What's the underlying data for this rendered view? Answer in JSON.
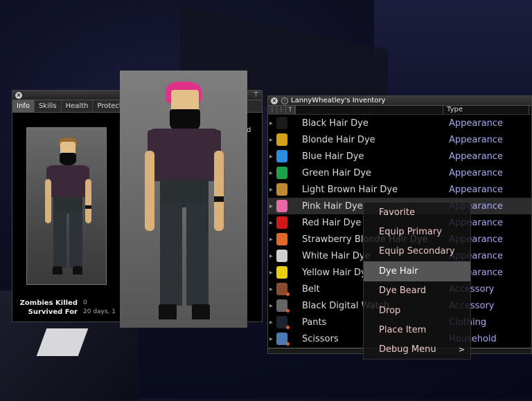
{
  "info_window": {
    "tabs": [
      {
        "label": "Info",
        "active": true
      },
      {
        "label": "Skills",
        "active": false
      },
      {
        "label": "Health",
        "active": false
      },
      {
        "label": "Protect",
        "active": false
      }
    ],
    "right_clip_text": "d",
    "stats": [
      {
        "label": "Zombies Killed",
        "value": "0"
      },
      {
        "label": "Survived For",
        "value": "20 days, 1"
      }
    ]
  },
  "inventory": {
    "title": "LannyWheatley's Inventory",
    "column_type": "Type",
    "items": [
      {
        "name": "Black Hair Dye",
        "type": "Appearance",
        "icon": "hair-dye-bottle-icon",
        "color": "#1a1a1a"
      },
      {
        "name": "Blonde Hair Dye",
        "type": "Appearance",
        "icon": "hair-dye-bottle-icon",
        "color": "#d4a017"
      },
      {
        "name": "Blue Hair Dye",
        "type": "Appearance",
        "icon": "hair-dye-bottle-icon",
        "color": "#2a8ee0"
      },
      {
        "name": "Green Hair Dye",
        "type": "Appearance",
        "icon": "hair-dye-bottle-icon",
        "color": "#1ea04a"
      },
      {
        "name": "Light Brown Hair Dye",
        "type": "Appearance",
        "icon": "hair-dye-bottle-icon",
        "color": "#c08830"
      },
      {
        "name": "Pink Hair Dye",
        "type": "Appearance",
        "icon": "hair-dye-bottle-icon",
        "color": "#e868a8",
        "selected": true
      },
      {
        "name": "Red Hair Dye",
        "type": "Appearance",
        "icon": "hair-dye-bottle-icon",
        "color": "#d01818"
      },
      {
        "name": "Strawberry Blonde Hair Dye",
        "type": "Appearance",
        "icon": "hair-dye-bottle-icon",
        "color": "#e06828"
      },
      {
        "name": "White Hair Dye",
        "type": "Appearance",
        "icon": "hair-dye-bottle-icon",
        "color": "#d0d0d0"
      },
      {
        "name": "Yellow Hair Dye",
        "type": "Appearance",
        "icon": "hair-dye-bottle-icon",
        "color": "#e8d010"
      },
      {
        "name": "Belt",
        "type": "Accessory",
        "icon": "belt-icon",
        "color": "#8a4a30",
        "equipped": true
      },
      {
        "name": "Black Digital Watch",
        "type": "Accessory",
        "icon": "watch-icon",
        "color": "#666666",
        "equipped": true
      },
      {
        "name": "Pants",
        "type": "Clothing",
        "icon": "pants-icon",
        "color": "#1c2430",
        "equipped": true
      },
      {
        "name": "Scissors",
        "type": "Household",
        "icon": "scissors-icon",
        "color": "#4a7ab0",
        "equipped": true
      }
    ]
  },
  "context_menu": {
    "items": [
      {
        "label": "Favorite"
      },
      {
        "label": "Equip Primary"
      },
      {
        "label": "Equip Secondary"
      },
      {
        "label": "Dye Hair",
        "highlighted": true
      },
      {
        "label": "Dye Beard"
      },
      {
        "label": "Drop"
      },
      {
        "label": "Place Item"
      },
      {
        "label": "Debug Menu",
        "submenu": ">"
      }
    ]
  },
  "character": {
    "hair_small": "#9a6a30",
    "hair_large": "#e0308a"
  }
}
